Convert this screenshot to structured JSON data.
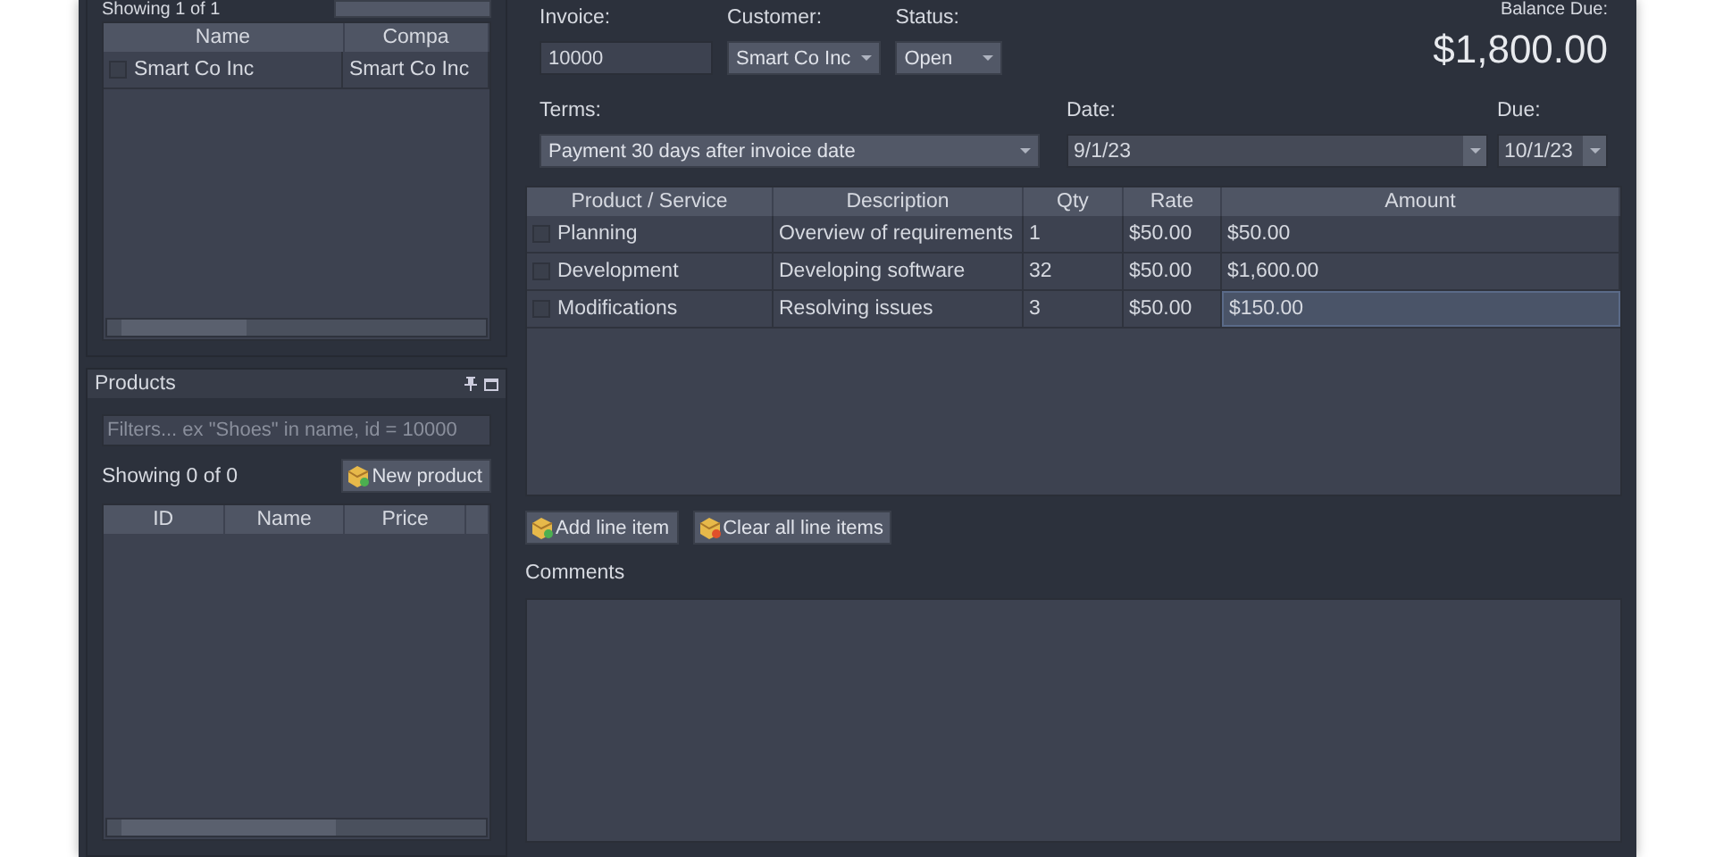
{
  "customers": {
    "showing": "Showing 1 of 1",
    "columns": [
      "Name",
      "Compa"
    ],
    "rows": [
      {
        "checked": false,
        "cells": [
          "Smart Co Inc",
          "Smart Co Inc"
        ]
      }
    ]
  },
  "products": {
    "title": "Products",
    "filter": {
      "placeholder": "Filters... ex \"Shoes\" in name, id = 10000"
    },
    "showing": "Showing 0 of 0",
    "new_button": "New product",
    "columns": [
      "ID",
      "Name",
      "Price",
      ""
    ]
  },
  "invoice": {
    "invoice_label": "Invoice:",
    "invoice_value": "10000",
    "customer_label": "Customer:",
    "customer_value": "Smart Co Inc",
    "status_label": "Status:",
    "status_value": "Open",
    "balance_label": "Balance Due:",
    "balance_value": "$1,800.00",
    "terms_label": "Terms:",
    "terms_value": "Payment 30 days after invoice date",
    "date_label": "Date:",
    "date_value": "9/1/23",
    "due_label": "Due:",
    "due_value": "10/1/23"
  },
  "line_items": {
    "columns": [
      "Product / Service",
      "Description",
      "Qty",
      "Rate",
      "Amount"
    ],
    "rows": [
      {
        "checked": false,
        "cells": [
          {
            "text": "Planning",
            "selected": false
          },
          {
            "text": "Overview of requirements",
            "selected": false
          },
          {
            "text": "1",
            "selected": false
          },
          {
            "text": "$50.00",
            "selected": false
          },
          {
            "text": "$50.00",
            "selected": false
          }
        ]
      },
      {
        "checked": false,
        "cells": [
          {
            "text": "Development",
            "selected": false
          },
          {
            "text": "Developing software",
            "selected": false
          },
          {
            "text": "32",
            "selected": false
          },
          {
            "text": "$50.00",
            "selected": false
          },
          {
            "text": "$1,600.00",
            "selected": false
          }
        ]
      },
      {
        "checked": false,
        "cells": [
          {
            "text": "Modifications",
            "selected": false
          },
          {
            "text": "Resolving issues",
            "selected": false
          },
          {
            "text": "3",
            "selected": false
          },
          {
            "text": "$50.00",
            "selected": false
          },
          {
            "text": "$150.00",
            "selected": true
          }
        ]
      }
    ]
  },
  "buttons": {
    "add": "Add line item",
    "clear": "Clear all line items"
  },
  "comments": {
    "label": "Comments"
  }
}
